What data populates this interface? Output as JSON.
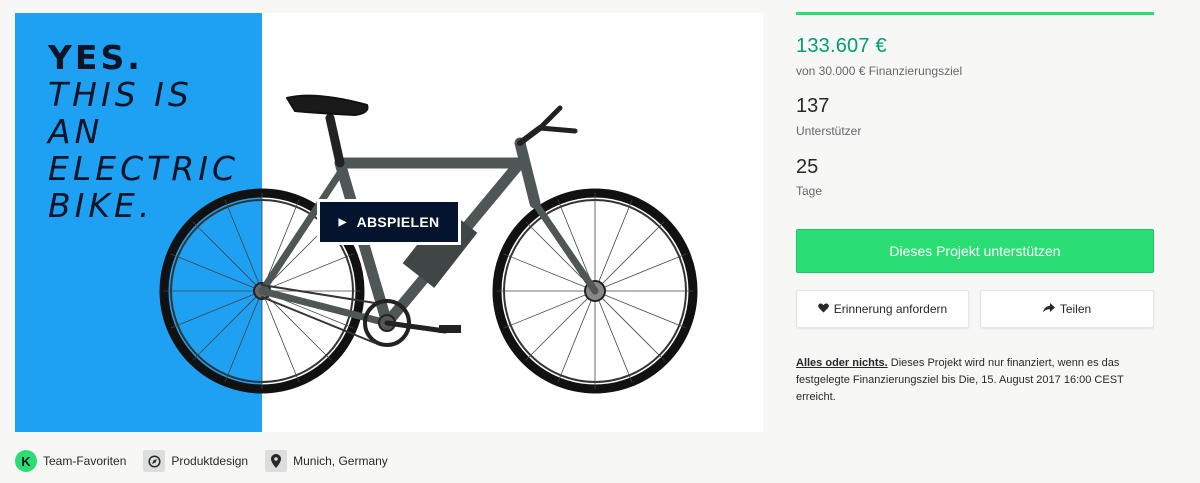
{
  "video": {
    "tagline": {
      "line1": "YES.",
      "line2": "THIS IS",
      "line3": "AN",
      "line4": "ELECTRIC",
      "line5": "BIKE."
    },
    "play_label": "ABSPIELEN",
    "play_icon": "play-icon"
  },
  "meta": {
    "badge_letter": "K",
    "favorites": "Team-Favoriten",
    "category": "Produktdesign",
    "location": "Munich, Germany"
  },
  "stats": {
    "progress_fraction": 1.0,
    "pledged": "133.607 €",
    "goal": "von 30.000 € Finanzierungsziel",
    "backers": "137",
    "backers_label": "Unterstützer",
    "days": "25",
    "days_label": "Tage"
  },
  "actions": {
    "back_label": "Dieses Projekt unterstützen",
    "remind_label": "Erinnerung anfordern",
    "share_label": "Teilen"
  },
  "notice": {
    "title": "Alles oder nichts.",
    "text": " Dieses Projekt wird nur finanziert, wenn es das festgelegte Finanzierungsziel bis Die, 15. August 2017 16:00 CEST erreicht."
  },
  "colors": {
    "accent_green": "#2bde73",
    "pledged_green": "#009e74",
    "panel_blue": "#1ea1f2",
    "dark_navy": "#05142e"
  }
}
